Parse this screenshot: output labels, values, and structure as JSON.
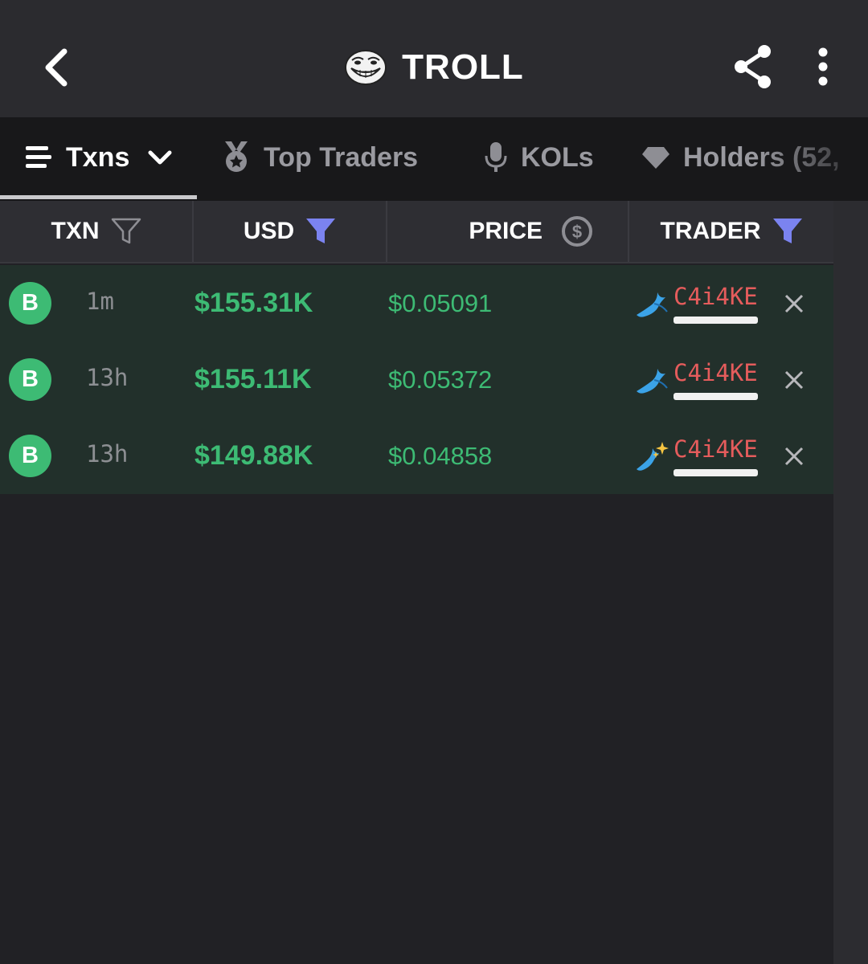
{
  "header": {
    "title": "TROLL",
    "icons": {
      "back": "chevron-left-icon",
      "logo": "troll-face-logo",
      "share": "share-icon",
      "more": "more-vertical-icon"
    }
  },
  "tabs": [
    {
      "label": "Txns",
      "icon": "list-icon",
      "active": true,
      "has_dropdown": true
    },
    {
      "label": "Top Traders",
      "icon": "medal-icon",
      "active": false
    },
    {
      "label": "KOLs",
      "icon": "microphone-icon",
      "active": false
    },
    {
      "label": "Holders (52,",
      "icon": "diamond-icon",
      "active": false
    }
  ],
  "table": {
    "columns": [
      {
        "label": "TXN",
        "icon": "filter-outline-icon"
      },
      {
        "label": "USD",
        "icon": "filter-active-icon"
      },
      {
        "label": "PRICE",
        "icon": "dollar-circle-icon"
      },
      {
        "label": "TRADER",
        "icon": "filter-active-icon"
      }
    ],
    "rows": [
      {
        "type": "B",
        "age": "1m",
        "usd": "$155.31K",
        "price": "$0.05091",
        "trader_emoji": "whale",
        "trader": "C4i4KE"
      },
      {
        "type": "B",
        "age": "13h",
        "usd": "$155.11K",
        "price": "$0.05372",
        "trader_emoji": "whale",
        "trader": "C4i4KE"
      },
      {
        "type": "B",
        "age": "13h",
        "usd": "$149.88K",
        "price": "$0.04858",
        "trader_emoji": "whale-sparkles",
        "trader": "C4i4KE"
      }
    ]
  },
  "colors": {
    "background": "#212125",
    "header_bg": "#2b2b2f",
    "tabs_bg": "#18181a",
    "row_bg": "#22302b",
    "buy_green": "#3dbb74",
    "trader_red": "#e55c5c",
    "filter_accent": "#7b83f0"
  }
}
